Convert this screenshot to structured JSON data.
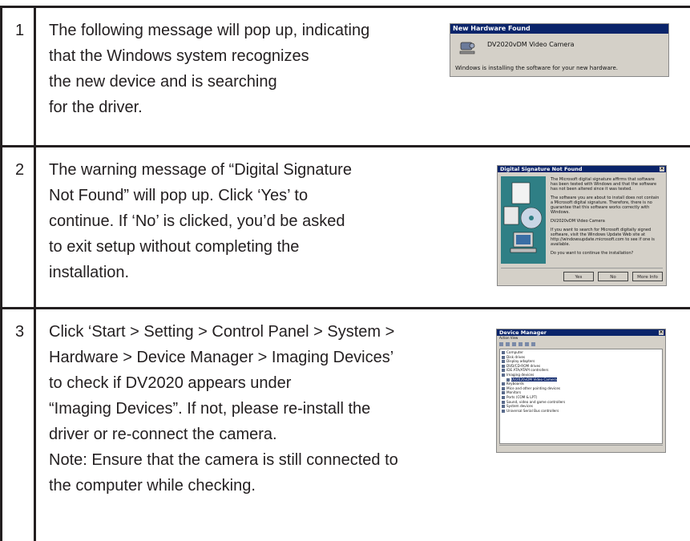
{
  "rows": [
    {
      "number": "1",
      "lines": [
        "The following message will pop up, indicating",
        "that the Windows system recognizes",
        "the new device and is searching",
        "for the driver."
      ]
    },
    {
      "number": "2",
      "lines": [
        "The warning message of “Digital Signature",
        "Not Found” will pop up. Click ‘Yes’ to",
        "continue. If ‘No’ is clicked, you’d be asked",
        "to exit setup without completing the",
        "installation."
      ]
    },
    {
      "number": "3",
      "lines": [
        "Click ‘Start > Setting > Control Panel > System >",
        "Hardware > Device Manager > Imaging Devices’",
        "to check if DV2020 appears under",
        "“Imaging Devices”.  If not, please re-install the",
        "driver or re-connect the camera.",
        "Note: Ensure that the camera is still connected to",
        "the computer while checking."
      ]
    }
  ],
  "screenshot1": {
    "title": "New Hardware Found",
    "device": "DV2020vDM Video Camera",
    "status": "Windows is installing the software for your new hardware."
  },
  "screenshot2": {
    "title": "Digital Signature Not Found",
    "para1": "The Microsoft digital signature affirms that software has been tested with Windows and that the software has not been altered since it was tested.",
    "para2": "The software you are about to install does not contain a Microsoft digital signature. Therefore, there is no guarantee that this software works correctly with Windows.",
    "device": "DV2020vDM Video Camera",
    "para3": "If you want to search for Microsoft digitally signed software, visit the Windows Update Web site at http://windowsupdate.microsoft.com to see if one is available.",
    "question": "Do you want to continue the installation?",
    "btn_yes": "Yes",
    "btn_no": "No",
    "btn_more": "More Info"
  },
  "screenshot3": {
    "title": "Device Manager",
    "menu": "Action   View",
    "tree": [
      "Computer",
      "Disk drives",
      "Display adapters",
      "DVD/CD-ROM drives",
      "IDE ATA/ATAPI controllers",
      "Imaging devices",
      "DV2020vDM Video Camera",
      "Keyboards",
      "Mice and other pointing devices",
      "Monitors",
      "Ports (COM & LPT)",
      "Sound, video and game controllers",
      "System devices",
      "Universal Serial Bus controllers"
    ]
  }
}
